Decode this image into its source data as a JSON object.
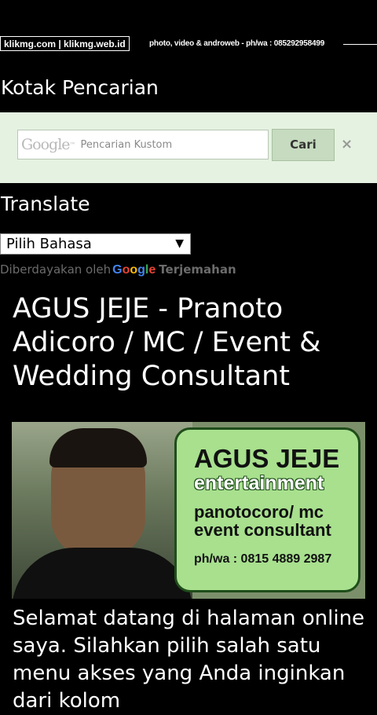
{
  "header": {
    "site_links": "klikmg.com | klikmg.web.id",
    "tagline": "photo, video & androweb - ph/wa : 085292958499"
  },
  "search_section": {
    "title": "Kotak Pencarian",
    "google_mark": "Google",
    "tm": "™",
    "placeholder": "Pencarian Kustom",
    "button_label": "Cari",
    "close_symbol": "×"
  },
  "translate_section": {
    "title": "Translate",
    "selected_language": "Pilih Bahasa",
    "dropdown_arrow": "▼",
    "powered_prefix": "Diberdayakan oleh",
    "google_letters": [
      "G",
      "o",
      "o",
      "g",
      "l",
      "e"
    ],
    "powered_suffix": "Terjemahan"
  },
  "post": {
    "title": "AGUS JEJE - Pranoto Adicoro / MC / Event & Wedding Consultant",
    "banner": {
      "name": "AGUS JEJE",
      "brand": "entertainment",
      "role_line1": "panotocoro/ mc",
      "role_line2": "event consultant",
      "phone": "ph/wa : 0815 4889 2987"
    },
    "welcome_text": "Selamat datang di halaman online saya. Silahkan pilih salah satu menu akses yang Anda inginkan dari kolom"
  },
  "icons": {
    "close": "close-icon",
    "dropdown": "chevron-down-icon"
  },
  "colors": {
    "page_background": "#000000",
    "search_panel": "#e5f2e1",
    "search_button": "#c6dbbf",
    "banner_card": "#a8e08e"
  }
}
